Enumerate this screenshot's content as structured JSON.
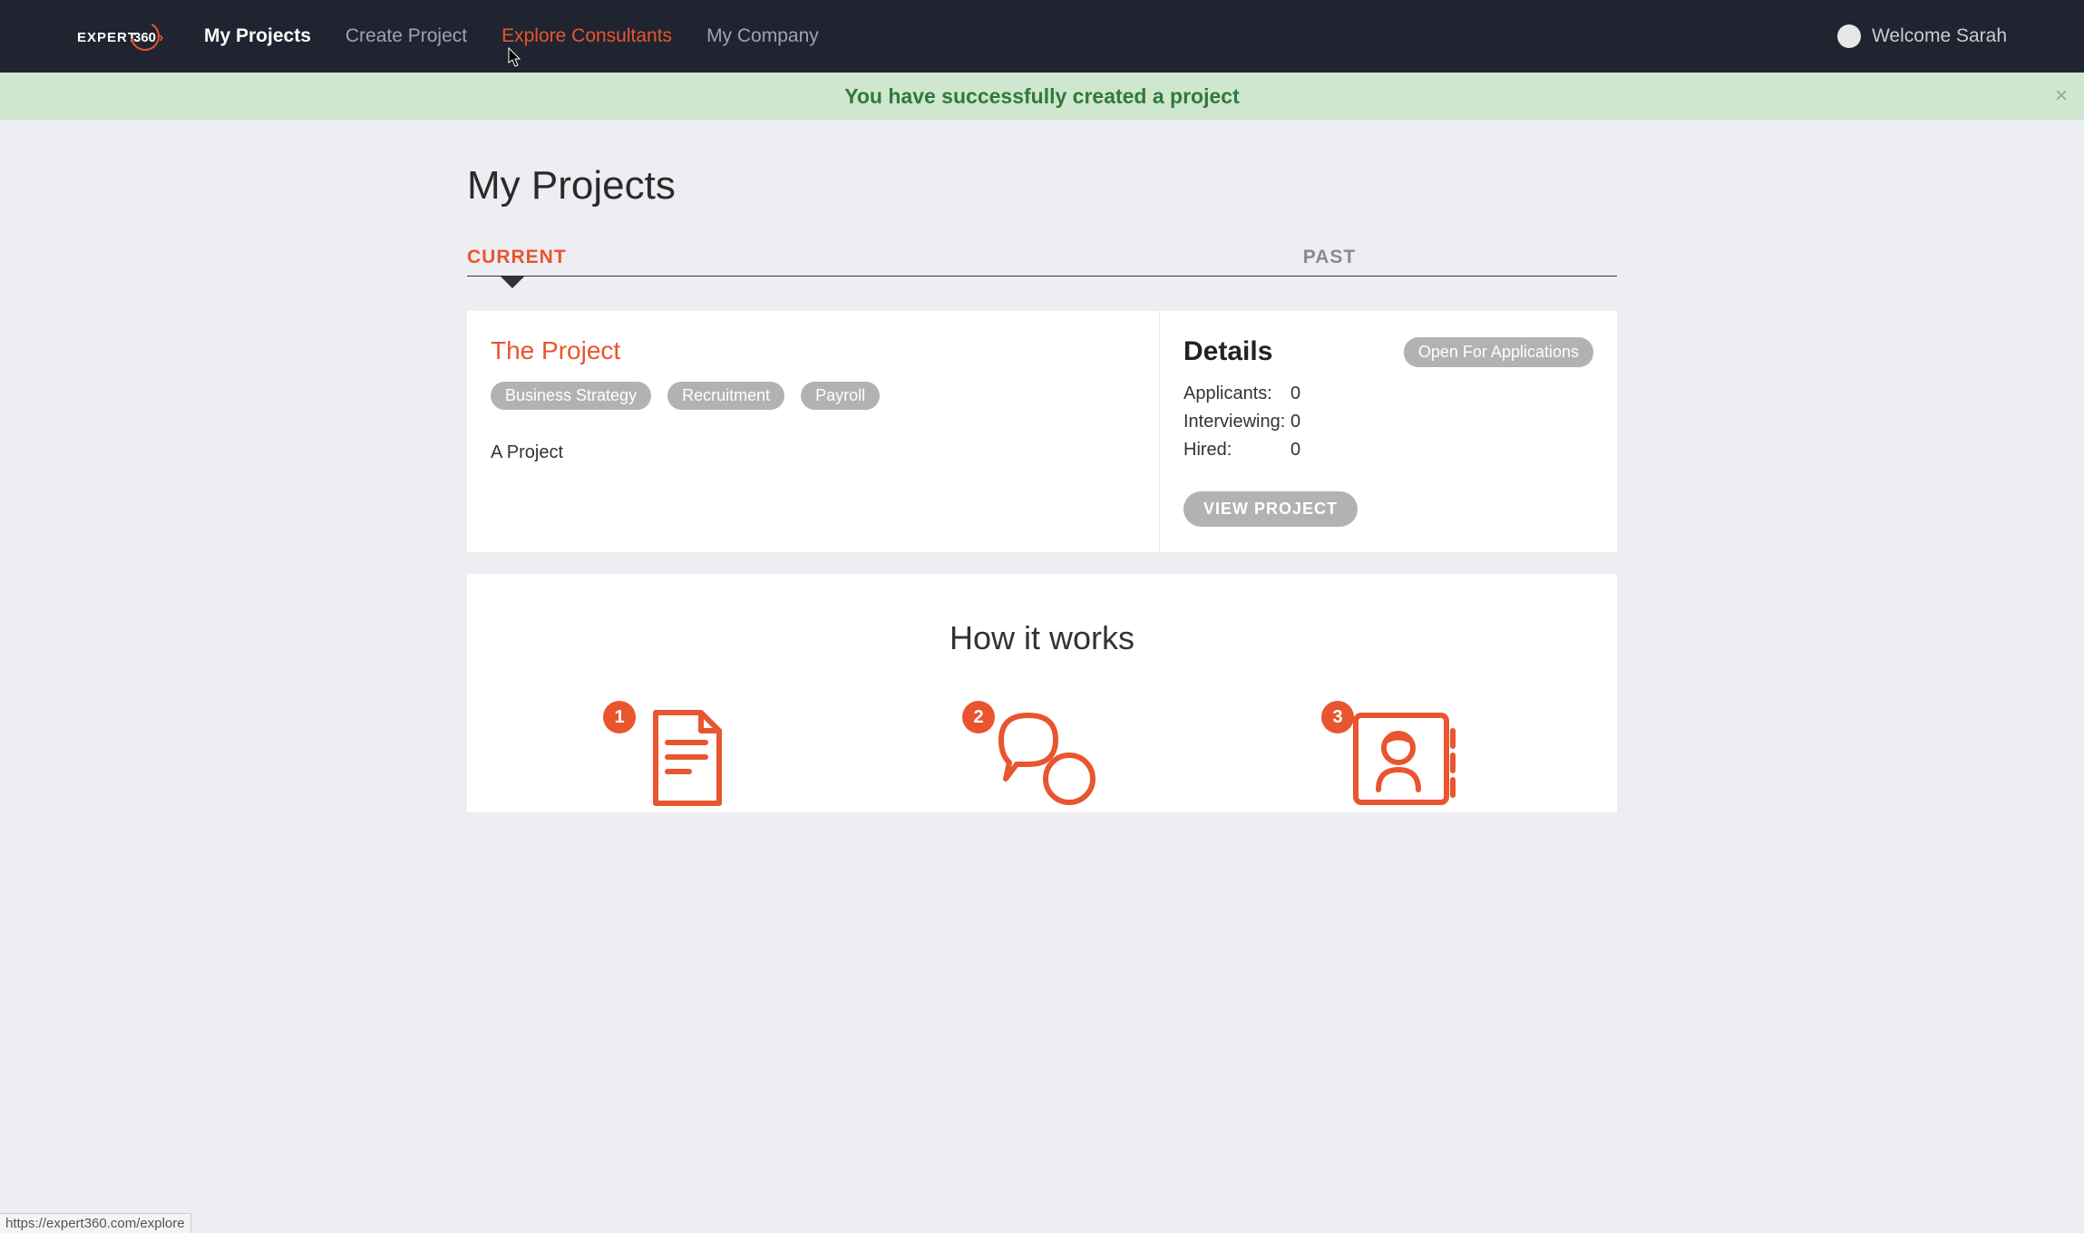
{
  "header": {
    "logo_text_a": "EXPERT",
    "logo_text_b": "360",
    "nav": [
      {
        "label": "My Projects",
        "state": "active"
      },
      {
        "label": "Create Project",
        "state": "normal"
      },
      {
        "label": "Explore Consultants",
        "state": "hover"
      },
      {
        "label": "My Company",
        "state": "normal"
      }
    ],
    "welcome": "Welcome Sarah"
  },
  "notification": {
    "message": "You have successfully created a project",
    "close": "×"
  },
  "page": {
    "title": "My Projects"
  },
  "tabs": [
    {
      "label": "CURRENT",
      "active": true
    },
    {
      "label": "PAST",
      "active": false
    }
  ],
  "project": {
    "title": "The Project",
    "tags": [
      "Business Strategy",
      "Recruitment",
      "Payroll"
    ],
    "description": "A Project",
    "details": {
      "heading": "Details",
      "status": "Open For Applications",
      "stats": {
        "applicants_label": "Applicants:",
        "applicants_value": "0",
        "interviewing_label": "Interviewing:",
        "interviewing_value": "0",
        "hired_label": "Hired:",
        "hired_value": "0"
      },
      "view_button": "VIEW PROJECT"
    }
  },
  "how": {
    "title": "How it works",
    "steps": [
      {
        "num": "1"
      },
      {
        "num": "2"
      },
      {
        "num": "3"
      }
    ]
  },
  "status_link": "https://expert360.com/explore"
}
